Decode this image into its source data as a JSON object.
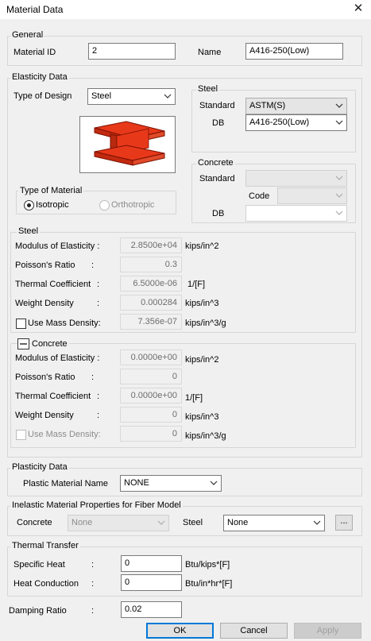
{
  "window": {
    "title": "Material Data",
    "close_glyph": "✕"
  },
  "general": {
    "legend": "General",
    "material_id_label": "Material ID",
    "material_id_value": "2",
    "name_label": "Name",
    "name_value": "A416-250(Low)"
  },
  "elasticity": {
    "legend": "Elasticity Data",
    "type_of_design_label": "Type of Design",
    "type_of_design_value": "Steel",
    "type_of_material": {
      "legend": "Type of Material",
      "isotropic": "Isotropic",
      "orthotropic": "Orthotropic",
      "selected": "Isotropic"
    },
    "steel_group": {
      "legend": "Steel",
      "standard_label": "Standard",
      "standard_value": "ASTM(S)",
      "db_label": "DB",
      "db_value": "A416-250(Low)"
    },
    "concrete_group": {
      "legend": "Concrete",
      "standard_label": "Standard",
      "standard_value": "",
      "code_label": "Code",
      "code_value": "",
      "db_label": "DB",
      "db_value": ""
    }
  },
  "steel_props": {
    "legend": "Steel",
    "modulus_label": "Modulus of Elasticity :",
    "modulus_value": "2.8500e+04",
    "modulus_unit": "kips/in^2",
    "poisson_label": "Poisson's Ratio",
    "poisson_colon": ":",
    "poisson_value": "0.3",
    "thermal_label": "Thermal Coefficient",
    "thermal_colon": ":",
    "thermal_value": "6.5000e-06",
    "thermal_unit": "1/[F]",
    "weight_label": "Weight Density",
    "weight_colon": ":",
    "weight_value": "0.000284",
    "weight_unit": "kips/in^3",
    "mass_label": "Use Mass Density:",
    "mass_value": "7.356e-07",
    "mass_unit": "kips/in^3/g",
    "mass_checked": false
  },
  "concrete_props": {
    "legend": "Concrete",
    "modulus_label": "Modulus of Elasticity :",
    "modulus_value": "0.0000e+00",
    "modulus_unit": "kips/in^2",
    "poisson_label": "Poisson's Ratio",
    "poisson_colon": ":",
    "poisson_value": "0",
    "thermal_label": "Thermal Coefficient",
    "thermal_colon": ":",
    "thermal_value": "0.0000e+00",
    "thermal_unit": "1/[F]",
    "weight_label": "Weight Density",
    "weight_colon": ":",
    "weight_value": "0",
    "weight_unit": "kips/in^3",
    "mass_label": "Use Mass Density:",
    "mass_value": "0",
    "mass_unit": "kips/in^3/g"
  },
  "plasticity": {
    "legend": "Plasticity Data",
    "plastic_label": "Plastic Material Name",
    "plastic_value": "NONE"
  },
  "inelastic": {
    "legend": "Inelastic Material Properties for Fiber Model",
    "concrete_label": "Concrete",
    "concrete_value": "None",
    "steel_label": "Steel",
    "steel_value": "None",
    "browse_label": "..."
  },
  "thermal": {
    "legend": "Thermal Transfer",
    "specific_heat_label": "Specific Heat",
    "specific_heat_colon": ":",
    "specific_heat_value": "0",
    "specific_heat_unit": "Btu/kips*[F]",
    "conduction_label": "Heat Conduction",
    "conduction_colon": ":",
    "conduction_value": "0",
    "conduction_unit": "Btu/in*hr*[F]"
  },
  "damping": {
    "label": "Damping Ratio",
    "colon": ":",
    "value": "0.02"
  },
  "buttons": {
    "ok": "OK",
    "cancel": "Cancel",
    "apply": "Apply"
  },
  "colors": {
    "beam_fill": "#e8381a",
    "beam_stroke": "#7a1000",
    "focus_blue": "#0078d7"
  }
}
